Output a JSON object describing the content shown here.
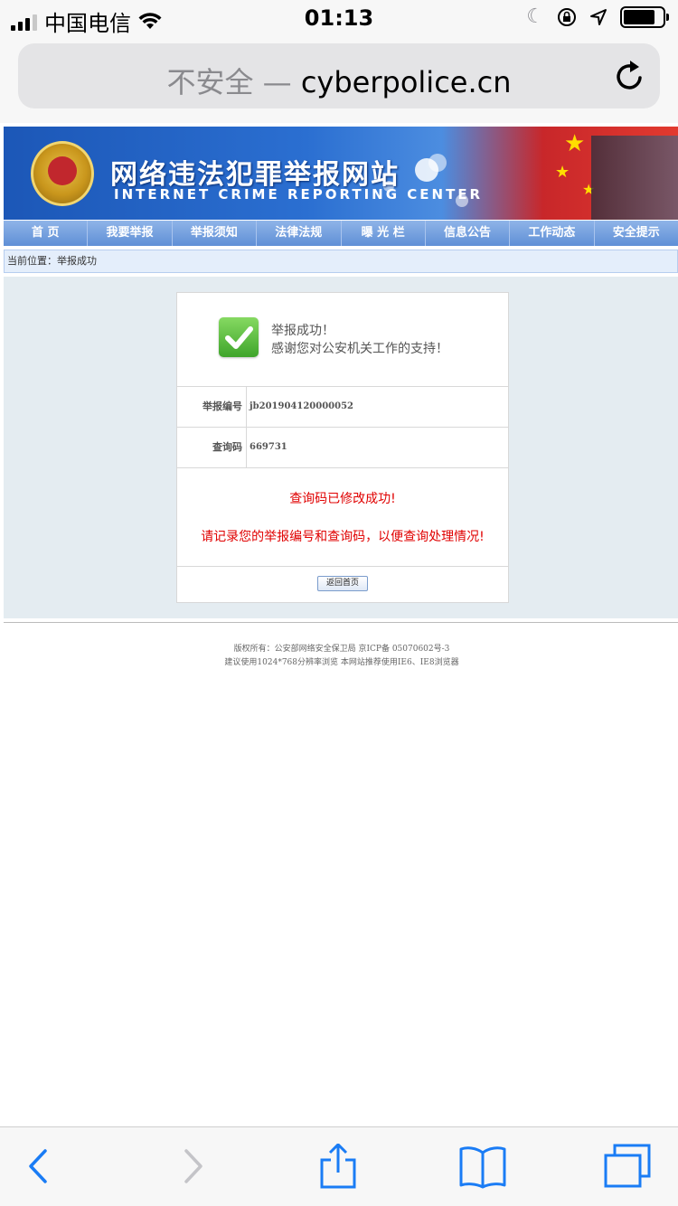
{
  "status_bar": {
    "carrier": "中国电信",
    "time": "01:13",
    "battery_level": 0.8
  },
  "browser": {
    "security_label": "不安全",
    "separator": "—",
    "domain": "cyberpolice.cn"
  },
  "site": {
    "title": "网络违法犯罪举报网站",
    "subtitle": "INTERNET CRIME REPORTING CENTER",
    "nav": [
      "首 页",
      "我要举报",
      "举报须知",
      "法律法规",
      "曝 光 栏",
      "信息公告",
      "工作动态",
      "安全提示"
    ]
  },
  "breadcrumb": "当前位置：举报成功",
  "result": {
    "title": "举报成功！",
    "message": "感谢您对公安机关工作的支持！",
    "report_id_label": "举报编号",
    "report_id": "jb201904120000052",
    "query_code_label": "查询码",
    "query_code": "669731",
    "notice_changed": "查询码已修改成功!",
    "notice_record": "请记录您的举报编号和查询码，以便查询处理情况!",
    "back_button": "返回首页"
  },
  "footer": {
    "line1": "版权所有：公安部网络安全保卫局 京ICP备 05070602号-3",
    "line2": "建议使用1024*768分辨率浏览 本网站推荐使用IE6、IE8浏览器"
  },
  "colors": {
    "nav_bg": "#6f9ce0",
    "alert_red": "#e00000",
    "ios_blue": "#1a7cf5"
  }
}
